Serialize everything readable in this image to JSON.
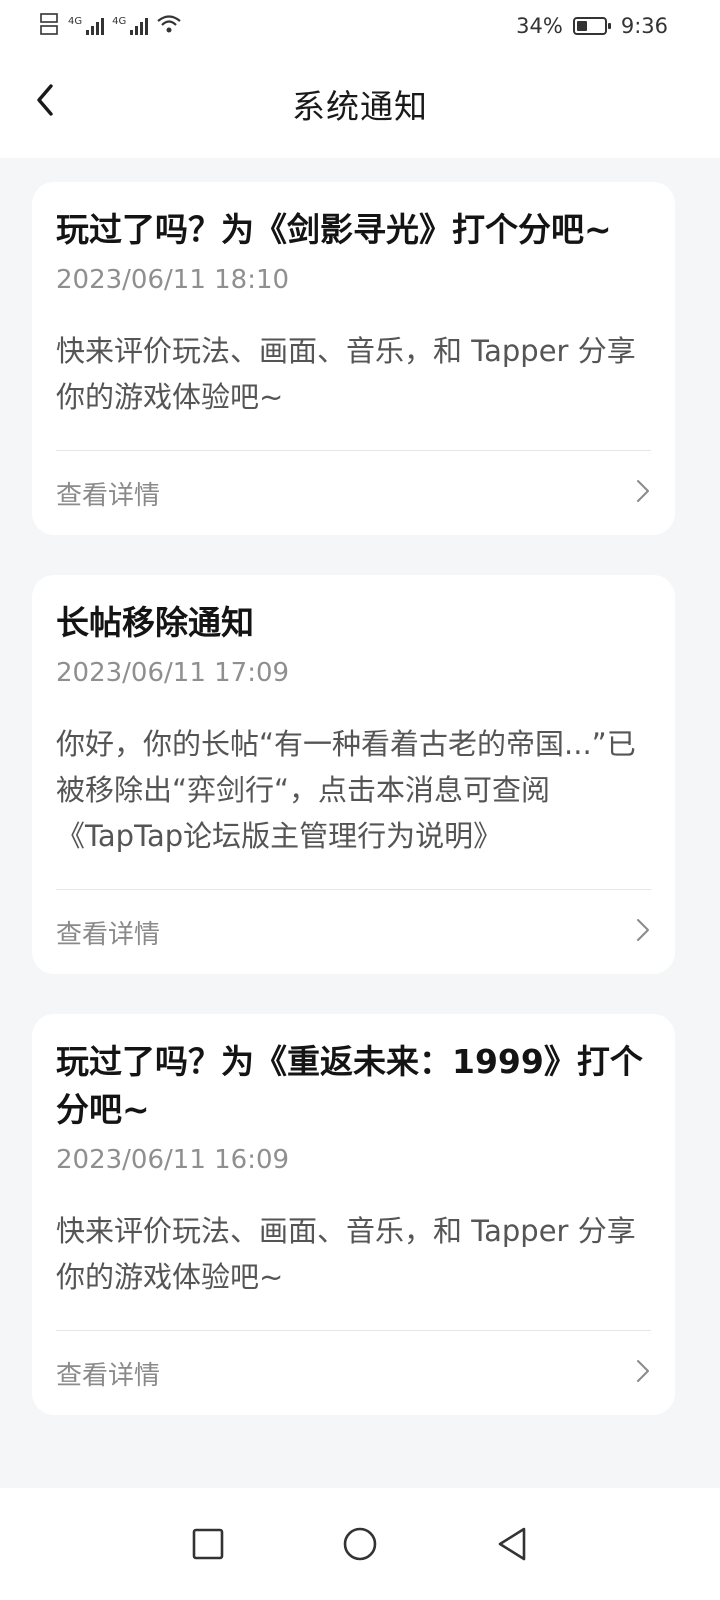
{
  "status_bar": {
    "network_1": "4G",
    "network_2": "4G",
    "battery": "34%",
    "time": "9:36"
  },
  "header": {
    "title": "系统通知"
  },
  "notifications": [
    {
      "title": "玩过了吗？为《剑影寻光》打个分吧~",
      "time": "2023/06/11 18:10",
      "body": "快来评价玩法、画面、音乐，和 Tapper 分享你的游戏体验吧~",
      "action": "查看详情"
    },
    {
      "title": "长帖移除通知",
      "time": "2023/06/11 17:09",
      "body": "你好，你的长帖“有一种看着古老的帝国...”已被移除出“弈剑行“，点击本消息可查阅《TapTap论坛版主管理行为说明》",
      "action": "查看详情"
    },
    {
      "title": "玩过了吗？为《重返未来：1999》打个分吧~",
      "time": "2023/06/11 16:09",
      "body": "快来评价玩法、画面、音乐，和 Tapper 分享你的游戏体验吧~",
      "action": "查看详情"
    }
  ],
  "icons": {
    "back": "chevron-left-icon",
    "detail": "chevron-right-icon",
    "nav": [
      "recent-apps-icon",
      "home-icon",
      "back-triangle-icon"
    ]
  }
}
